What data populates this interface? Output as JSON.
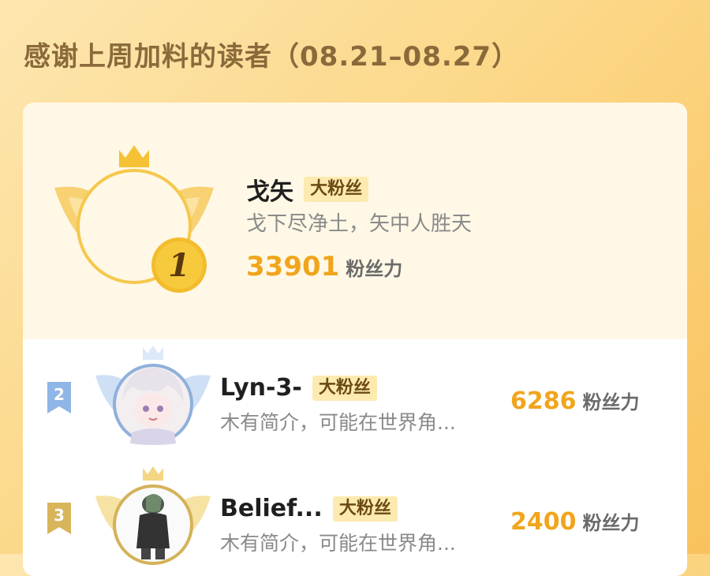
{
  "page": {
    "title": "感谢上周加料的读者（08.21–08.27）"
  },
  "colors": {
    "accent": "#f0a51c",
    "badge_bg": "#fdeab0",
    "rank2": "#8fb6e6",
    "rank3": "#d8b55a"
  },
  "ranking": [
    {
      "rank": "1",
      "name": "戈矢",
      "badge": "大粉丝",
      "signature": "戈下尽净土，矢中人胜天",
      "score": "33901",
      "score_unit": "粉丝力"
    },
    {
      "rank": "2",
      "name": "Lyn-3-",
      "badge": "大粉丝",
      "signature": "木有简介，可能在世界角...",
      "score": "6286",
      "score_unit": "粉丝力"
    },
    {
      "rank": "3",
      "name": "Belief...",
      "badge": "大粉丝",
      "signature": "木有简介，可能在世界角...",
      "score": "2400",
      "score_unit": "粉丝力"
    }
  ]
}
